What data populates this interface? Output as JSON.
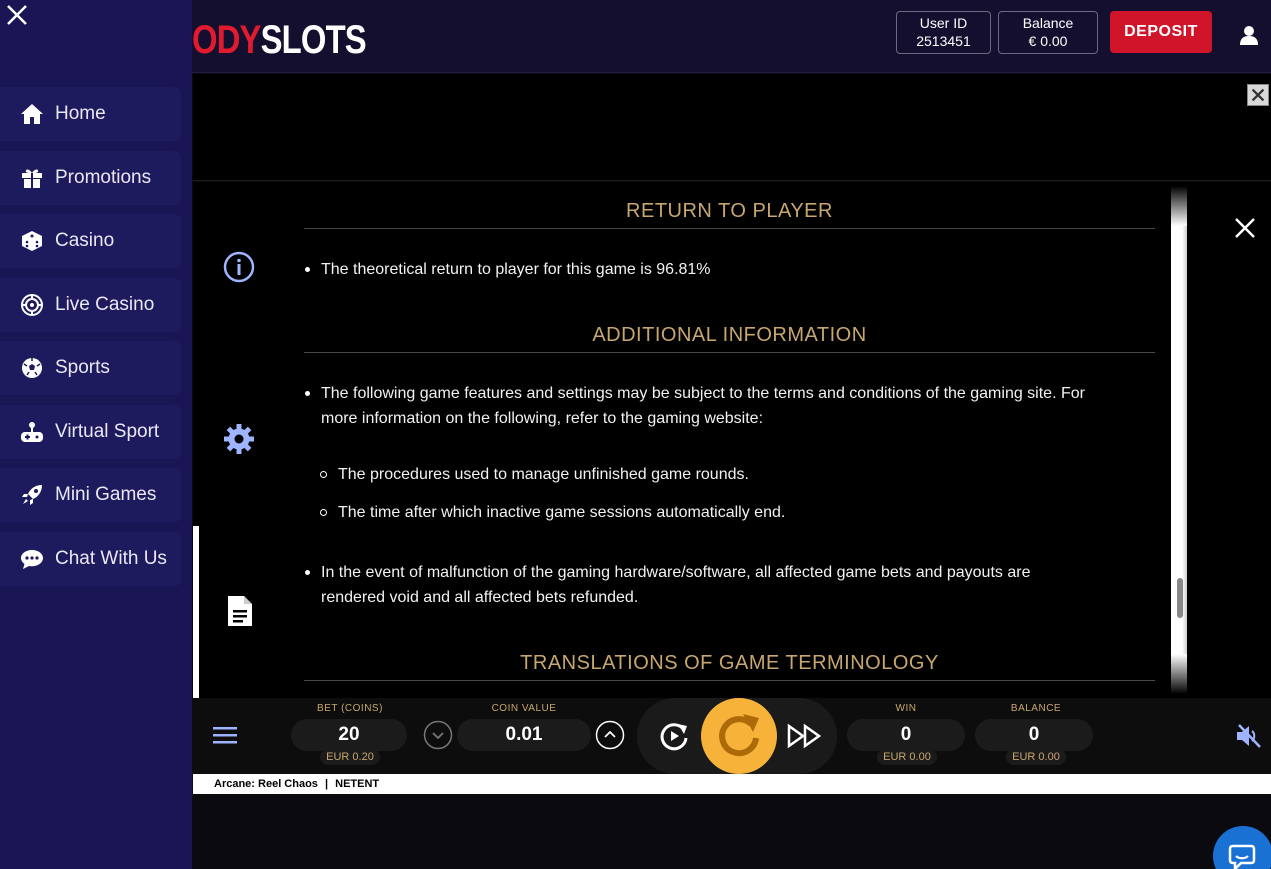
{
  "header": {
    "logo_part_red": "ODY",
    "logo_part_white": "SLOTS",
    "user_id_label": "User ID",
    "user_id_value": "2513451",
    "balance_label": "Balance",
    "balance_value": "€ 0.00",
    "deposit_label": "DEPOSIT"
  },
  "sidebar": {
    "items": [
      {
        "label": "Home",
        "icon": "home-icon"
      },
      {
        "label": "Promotions",
        "icon": "gift-icon"
      },
      {
        "label": "Casino",
        "icon": "dice-icon"
      },
      {
        "label": "Live Casino",
        "icon": "roulette-icon"
      },
      {
        "label": "Sports",
        "icon": "soccer-ball-icon"
      },
      {
        "label": "Virtual Sport",
        "icon": "gamepad-icon"
      },
      {
        "label": "Mini Games",
        "icon": "rocket-icon"
      },
      {
        "label": "Chat With Us",
        "icon": "chat-icon"
      }
    ]
  },
  "info_panel": {
    "section_rtp_title": "RETURN TO PLAYER",
    "rtp_text": "The theoretical return to player for this game is 96.81%",
    "section_additional_title": "ADDITIONAL INFORMATION",
    "additional_intro_line1": "The following game features and settings may be subject to the terms and conditions of the gaming site. For",
    "additional_intro_line2": "more information on the following, refer to the gaming website:",
    "sub_item_1": "The procedures used to manage unfinished game rounds.",
    "sub_item_2": "The time after which inactive game sessions automatically end.",
    "malfunction_line1": "In the event of malfunction of the gaming hardware/software, all affected game bets and payouts are",
    "malfunction_line2": "rendered void and all affected bets refunded.",
    "section_translations_title": "TRANSLATIONS OF GAME TERMINOLOGY"
  },
  "controls": {
    "bet_label": "BET (COINS)",
    "bet_value": "20",
    "bet_eur": "EUR 0.20",
    "coin_value_label": "COIN VALUE",
    "coin_value": "0.01",
    "win_label": "WIN",
    "win_value": "0",
    "win_eur": "EUR 0.00",
    "balance_label": "BALANCE",
    "balance_value": "0",
    "balance_eur": "EUR 0.00"
  },
  "footer": {
    "game_name": "Arcane: Reel Chaos",
    "separator": "|",
    "provider": "NETENT"
  },
  "colors": {
    "sidebar_bg": "#1a1554",
    "header_bg": "#140f2e",
    "deposit_red": "#d0142a",
    "gold": "#c8a76e",
    "spin_orange": "#f7b339",
    "chat_blue": "#1971d4"
  }
}
